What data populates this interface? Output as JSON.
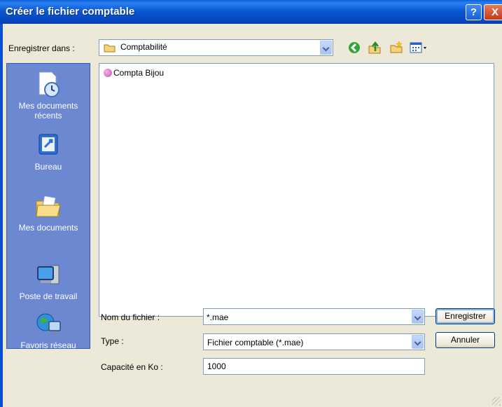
{
  "window": {
    "title": "Créer le fichier comptable",
    "help_label": "?",
    "close_label": "X"
  },
  "toolbar": {
    "save_in_label": "Enregistrer dans :",
    "save_in_value": "Comptabilité"
  },
  "places": [
    {
      "label": "Mes documents récents"
    },
    {
      "label": "Bureau"
    },
    {
      "label": "Mes documents"
    },
    {
      "label": "Poste de travail"
    },
    {
      "label": "Favoris réseau"
    }
  ],
  "files": [
    {
      "name": "Compta Bijou"
    }
  ],
  "form": {
    "filename_label": "Nom du fichier :",
    "filename_value": "*.mae",
    "type_label": "Type :",
    "type_value": "Fichier comptable (*.mae)",
    "capacity_label": "Capacité en Ko :",
    "capacity_value": "1000"
  },
  "buttons": {
    "save": "Enregistrer",
    "cancel": "Annuler"
  },
  "colors": {
    "titlebar": "#0855d0",
    "places_bar": "#6b88d0",
    "dialog_bg": "#ece9d8"
  }
}
